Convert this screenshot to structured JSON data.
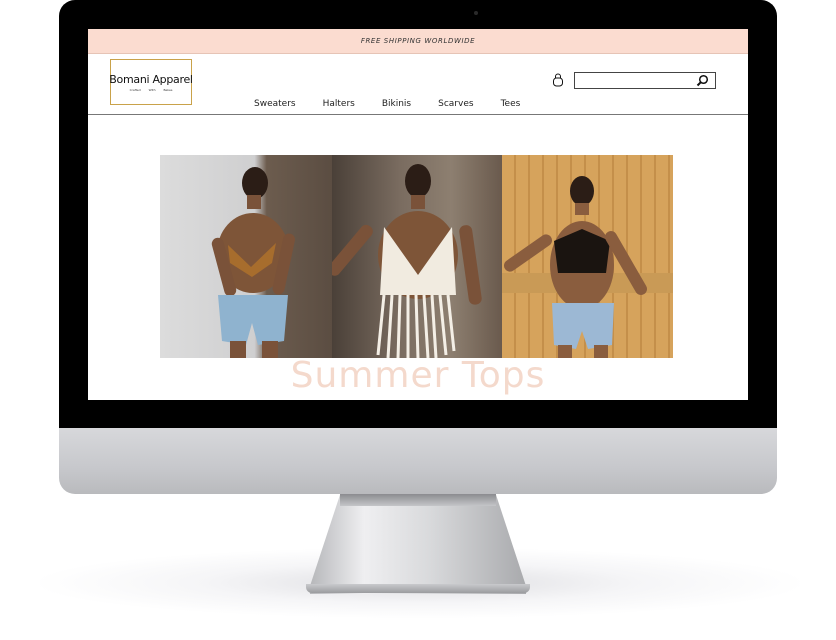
{
  "promo": {
    "text": "FREE SHIPPING WORLDWIDE"
  },
  "brand": {
    "name": "Bomani Apparel",
    "tagline": [
      "Crafted",
      "With",
      "Bekes"
    ],
    "accent": "#c9a24a"
  },
  "nav": {
    "items": [
      {
        "label": "Sweaters"
      },
      {
        "label": "Halters"
      },
      {
        "label": "Bikinis"
      },
      {
        "label": "Scarves"
      },
      {
        "label": "Tees"
      }
    ]
  },
  "search": {
    "value": ""
  },
  "icons": {
    "cart": "shopping-bag-icon",
    "search": "search-icon"
  },
  "hero": {
    "title": "Summer Tops",
    "title_color": "#f4d9cc"
  },
  "colors": {
    "promo_background": "#fbdcd0",
    "bezel": "#000000",
    "chin": "#c7c8cc"
  }
}
